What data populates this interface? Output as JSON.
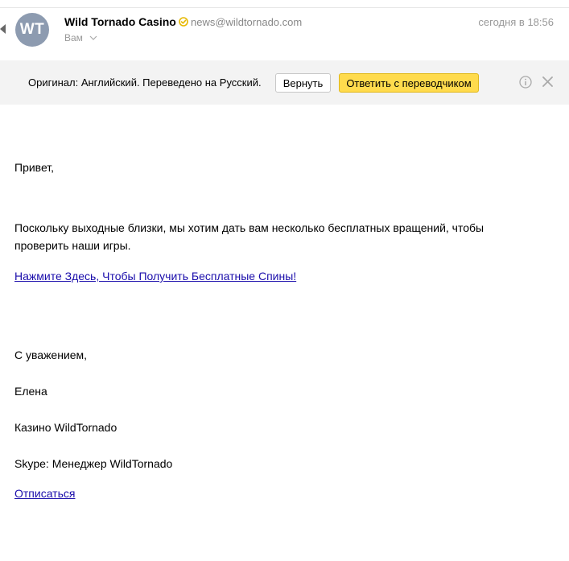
{
  "header": {
    "avatar_initials": "WT",
    "avatar_color": "#8d9bb0",
    "sender_name": "Wild Tornado Casino",
    "sender_email": "news@wildtornado.com",
    "date": "сегодня в 18:56",
    "recipient": "Вам"
  },
  "translation": {
    "text": "Оригинал: Английский. Переведено на Русский.",
    "revert_label": "Вернуть",
    "reply_label": "Ответить с переводчиком",
    "reply_color": "#ffdb4d"
  },
  "message": {
    "greeting": "Привет,",
    "paragraph_line1": "Поскольку выходные близки, мы хотим дать вам несколько бесплатных вращений, чтобы",
    "paragraph_line2": "проверить наши игры.",
    "link_label": "Нажмите Здесь, Чтобы Получить Бесплатные Спины!",
    "closing": "С уважением,",
    "signature_name": "Елена",
    "signature_company": "Казино WildTornado",
    "signature_skype": "Skype: Менеджер WildTornado",
    "unsubscribe_label": "Отписаться"
  },
  "icons": {
    "back": "back-arrow-icon",
    "verified": "verified-icon",
    "chevron": "chevron-down-icon",
    "info": "info-icon",
    "close": "close-icon"
  }
}
